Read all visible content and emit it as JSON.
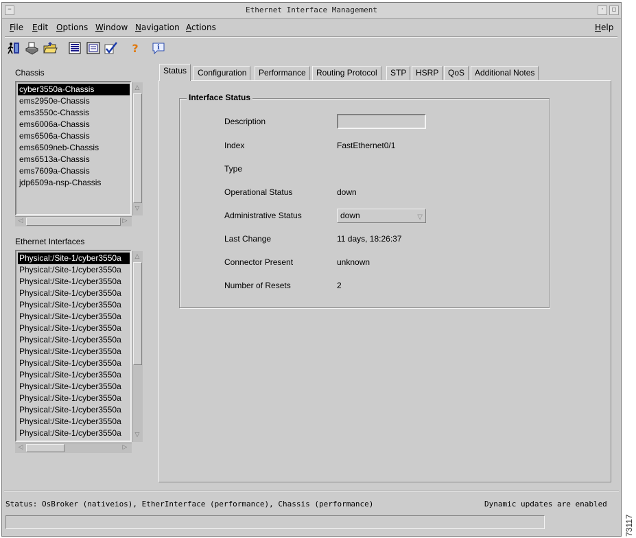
{
  "window": {
    "title": "Ethernet Interface Management"
  },
  "menubar": {
    "file": "File",
    "edit": "Edit",
    "options": "Options",
    "window": "Window",
    "navigation": "Navigation",
    "actions": "Actions",
    "help": "Help"
  },
  "toolbar": {
    "icons": [
      "exit-icon",
      "print-icon",
      "open-folder-icon",
      "list-icon",
      "details-icon",
      "check-icon",
      "help-icon",
      "info-icon"
    ]
  },
  "chassis": {
    "label": "Chassis",
    "items": [
      "cyber3550a-Chassis",
      "ems2950e-Chassis",
      "ems3550c-Chassis",
      "ems6006a-Chassis",
      "ems6506a-Chassis",
      "ems6509neb-Chassis",
      "ems6513a-Chassis",
      "ems7609a-Chassis",
      "jdp6509a-nsp-Chassis"
    ],
    "selected_index": 0
  },
  "interfaces": {
    "label": "Ethernet Interfaces",
    "items": [
      "Physical:/Site-1/cyber3550a",
      "Physical:/Site-1/cyber3550a",
      "Physical:/Site-1/cyber3550a",
      "Physical:/Site-1/cyber3550a",
      "Physical:/Site-1/cyber3550a",
      "Physical:/Site-1/cyber3550a",
      "Physical:/Site-1/cyber3550a",
      "Physical:/Site-1/cyber3550a",
      "Physical:/Site-1/cyber3550a",
      "Physical:/Site-1/cyber3550a",
      "Physical:/Site-1/cyber3550a",
      "Physical:/Site-1/cyber3550a",
      "Physical:/Site-1/cyber3550a",
      "Physical:/Site-1/cyber3550a",
      "Physical:/Site-1/cyber3550a",
      "Physical:/Site-1/cyber3550a"
    ],
    "selected_index": 0
  },
  "tabs": [
    "Status",
    "Configuration",
    "Performance",
    "Routing Protocol",
    "STP",
    "HSRP",
    "QoS",
    "Additional Notes"
  ],
  "active_tab": "Status",
  "interface_status": {
    "group_title": "Interface Status",
    "description_label": "Description",
    "description_value": "",
    "index_label": "Index",
    "index_value": "FastEthernet0/1",
    "type_label": "Type",
    "type_value": "",
    "operational_label": "Operational Status",
    "operational_value": "down",
    "admin_label": "Administrative Status",
    "admin_value": "down",
    "last_change_label": "Last Change",
    "last_change_value": "11 days, 18:26:37",
    "connector_label": "Connector Present",
    "connector_value": "unknown",
    "resets_label": "Number of Resets",
    "resets_value": "2"
  },
  "statusbar": {
    "status_text": "Status: OsBroker (nativeios), EtherInterface (performance), Chassis (performance)",
    "updates_text": "Dynamic updates are enabled"
  },
  "figure_id": "73117"
}
